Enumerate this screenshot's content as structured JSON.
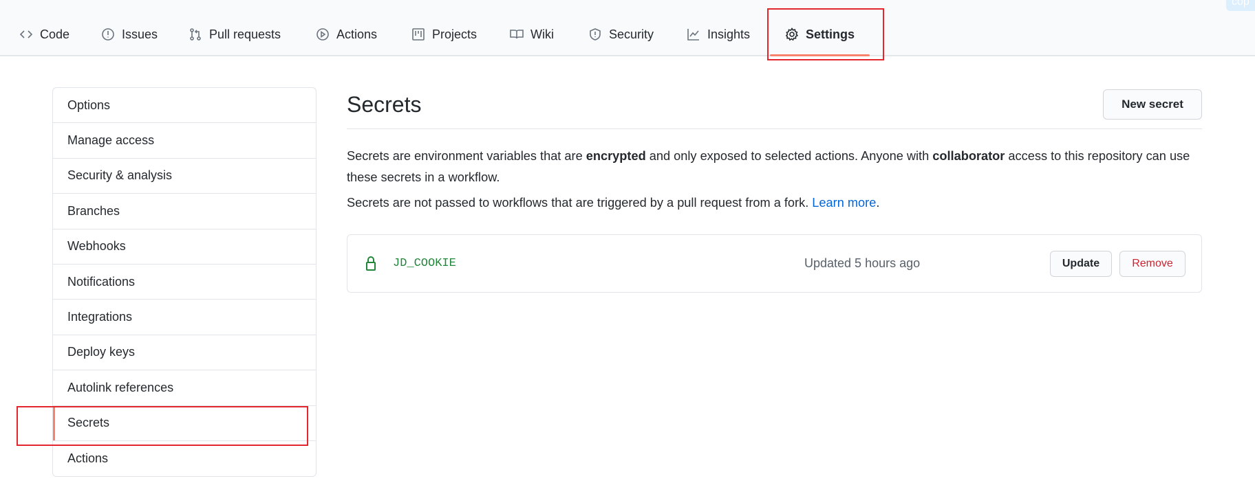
{
  "nav": {
    "tabs": [
      {
        "label": "Code",
        "icon": "code-icon"
      },
      {
        "label": "Issues",
        "icon": "issue-icon"
      },
      {
        "label": "Pull requests",
        "icon": "pull-request-icon"
      },
      {
        "label": "Actions",
        "icon": "play-icon"
      },
      {
        "label": "Projects",
        "icon": "project-icon"
      },
      {
        "label": "Wiki",
        "icon": "book-icon"
      },
      {
        "label": "Security",
        "icon": "shield-icon"
      },
      {
        "label": "Insights",
        "icon": "graph-icon"
      },
      {
        "label": "Settings",
        "icon": "gear-icon",
        "active": true
      }
    ],
    "corner_badge": "cop"
  },
  "sidebar": {
    "items": [
      "Options",
      "Manage access",
      "Security & analysis",
      "Branches",
      "Webhooks",
      "Notifications",
      "Integrations",
      "Deploy keys",
      "Autolink references",
      "Secrets",
      "Actions"
    ],
    "active": "Secrets"
  },
  "main": {
    "title": "Secrets",
    "new_secret_label": "New secret",
    "para1_a": "Secrets are environment variables that are ",
    "para1_b": "encrypted",
    "para1_c": " and only exposed to selected actions. Anyone with ",
    "para1_d": "collaborator",
    "para1_e": " access to this repository can use these secrets in a workflow.",
    "para2_a": "Secrets are not passed to workflows that are triggered by a pull request from a fork. ",
    "para2_link": "Learn more",
    "para2_end": ".",
    "secrets": [
      {
        "name": "JD_COOKIE",
        "updated": "Updated 5 hours ago",
        "update_label": "Update",
        "remove_label": "Remove"
      }
    ]
  },
  "colors": {
    "accent": "#f9826c",
    "link": "#0366d6",
    "secret_name": "#22863a",
    "danger": "#cb2431",
    "highlight": "#e3262b"
  }
}
